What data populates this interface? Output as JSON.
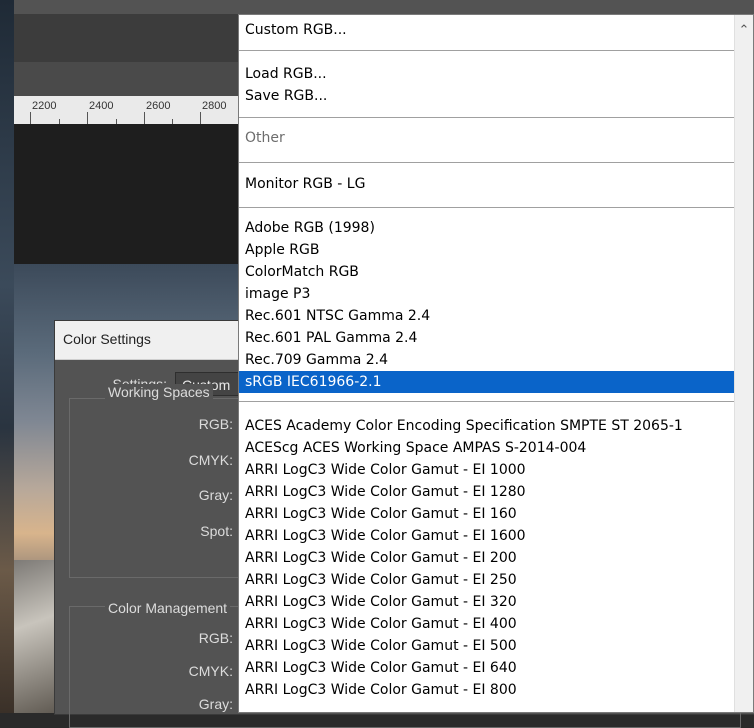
{
  "ruler": {
    "labels": [
      "2200",
      "2400",
      "2600",
      "2800"
    ]
  },
  "dialog": {
    "title": "Color Settings",
    "settings_label": "Settings:",
    "settings_value": "Custom",
    "working_spaces": {
      "title": "Working Spaces",
      "rgb_label": "RGB:",
      "cmyk_label": "CMYK:",
      "gray_label": "Gray:",
      "spot_label": "Spot:"
    },
    "color_management": {
      "title": "Color Management",
      "rgb_label": "RGB:",
      "cmyk_label": "CMYK:",
      "gray_label": "Gray:"
    }
  },
  "dropdown": {
    "group1": [
      "Custom RGB..."
    ],
    "group2": [
      "Load RGB...",
      "Save RGB..."
    ],
    "group3": [
      "Other"
    ],
    "group4": [
      "Monitor RGB - LG"
    ],
    "group5": [
      "Adobe RGB (1998)",
      "Apple RGB",
      "ColorMatch RGB",
      "image P3",
      "Rec.601 NTSC Gamma 2.4",
      "Rec.601 PAL Gamma 2.4",
      "Rec.709 Gamma 2.4",
      "sRGB IEC61966-2.1"
    ],
    "selected": "sRGB IEC61966-2.1",
    "group6": [
      "ACES Academy Color Encoding Specification SMPTE ST 2065-1",
      "ACEScg ACES Working Space AMPAS S-2014-004",
      "ARRI LogC3 Wide Color Gamut - EI 1000",
      "ARRI LogC3 Wide Color Gamut - EI 1280",
      "ARRI LogC3 Wide Color Gamut - EI 160",
      "ARRI LogC3 Wide Color Gamut - EI 1600",
      "ARRI LogC3 Wide Color Gamut - EI 200",
      "ARRI LogC3 Wide Color Gamut - EI 250",
      "ARRI LogC3 Wide Color Gamut - EI 320",
      "ARRI LogC3 Wide Color Gamut - EI 400",
      "ARRI LogC3 Wide Color Gamut - EI 500",
      "ARRI LogC3 Wide Color Gamut - EI 640",
      "ARRI LogC3 Wide Color Gamut - EI 800"
    ],
    "scroll_up_icon": "chevron-up-icon"
  },
  "colors": {
    "selection": "#0a64c9",
    "dialog_bg": "#535353",
    "dropdown_bg": "#ffffff"
  }
}
